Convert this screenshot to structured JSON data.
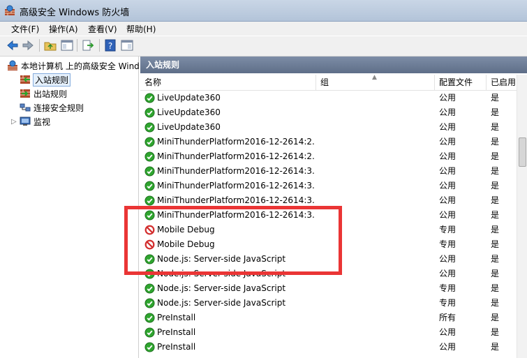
{
  "window": {
    "title": "高级安全 Windows 防火墙"
  },
  "menu": [
    {
      "label": "文件(F)"
    },
    {
      "label": "操作(A)"
    },
    {
      "label": "查看(V)"
    },
    {
      "label": "帮助(H)"
    }
  ],
  "toolbar": {
    "icons": [
      "back-arrow",
      "forward-arrow",
      "up-folder",
      "show-hide-tree",
      "export",
      "help",
      "show-hide-action-pane"
    ]
  },
  "tree": [
    {
      "label": "本地计算机 上的高级安全 Wind",
      "icon": "firewall-computer"
    },
    {
      "label": "入站规则",
      "icon": "inbound-rules",
      "selected": true
    },
    {
      "label": "出站规则",
      "icon": "outbound-rules"
    },
    {
      "label": "连接安全规则",
      "icon": "connection-security"
    },
    {
      "label": "监视",
      "icon": "monitor"
    }
  ],
  "pane": {
    "title": "入站规则"
  },
  "columns": [
    {
      "label": "名称"
    },
    {
      "label": "组"
    },
    {
      "label": "配置文件"
    },
    {
      "label": "已启用"
    }
  ],
  "rules": [
    {
      "name": "LiveUpdate360",
      "profile": "公用",
      "enabled": "是",
      "status": "allow"
    },
    {
      "name": "LiveUpdate360",
      "profile": "公用",
      "enabled": "是",
      "status": "allow"
    },
    {
      "name": "LiveUpdate360",
      "profile": "公用",
      "enabled": "是",
      "status": "allow"
    },
    {
      "name": "MiniThunderPlatform2016-12-2614:2...",
      "profile": "公用",
      "enabled": "是",
      "status": "allow"
    },
    {
      "name": "MiniThunderPlatform2016-12-2614:2...",
      "profile": "公用",
      "enabled": "是",
      "status": "allow"
    },
    {
      "name": "MiniThunderPlatform2016-12-2614:3...",
      "profile": "公用",
      "enabled": "是",
      "status": "allow"
    },
    {
      "name": "MiniThunderPlatform2016-12-2614:3...",
      "profile": "公用",
      "enabled": "是",
      "status": "allow"
    },
    {
      "name": "MiniThunderPlatform2016-12-2614:3...",
      "profile": "公用",
      "enabled": "是",
      "status": "allow"
    },
    {
      "name": "MiniThunderPlatform2016-12-2614:3...",
      "profile": "公用",
      "enabled": "是",
      "status": "allow"
    },
    {
      "name": "Mobile Debug",
      "profile": "专用",
      "enabled": "是",
      "status": "block"
    },
    {
      "name": "Mobile Debug",
      "profile": "专用",
      "enabled": "是",
      "status": "block"
    },
    {
      "name": "Node.js: Server-side JavaScript",
      "profile": "公用",
      "enabled": "是",
      "status": "allow"
    },
    {
      "name": "Node.js: Server-side JavaScript",
      "profile": "公用",
      "enabled": "是",
      "status": "allow"
    },
    {
      "name": "Node.js: Server-side JavaScript",
      "profile": "专用",
      "enabled": "是",
      "status": "allow"
    },
    {
      "name": "Node.js: Server-side JavaScript",
      "profile": "专用",
      "enabled": "是",
      "status": "allow"
    },
    {
      "name": "PreInstall",
      "profile": "所有",
      "enabled": "是",
      "status": "allow"
    },
    {
      "name": "PreInstall",
      "profile": "公用",
      "enabled": "是",
      "status": "allow"
    },
    {
      "name": "PreInstall",
      "profile": "公用",
      "enabled": "是",
      "status": "allow"
    }
  ],
  "colors": {
    "allow": "#2fa52f",
    "block": "#d32f2f",
    "highlight": "#ea3535"
  }
}
